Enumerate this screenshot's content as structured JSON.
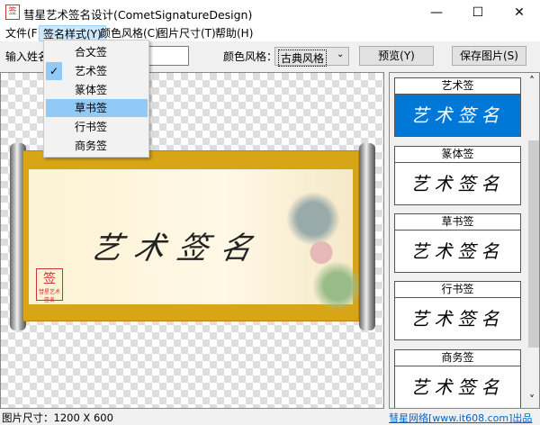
{
  "window": {
    "title": "彗星艺术签名设计(CometSignatureDesign)",
    "icon_text": "签",
    "minimize": "—",
    "maximize": "☐",
    "close": "✕"
  },
  "menubar": [
    "文件(F)",
    "签名样式(Y)",
    "颜色风格(C)",
    "图片尺寸(T)",
    "帮助(H)"
  ],
  "dropdown": {
    "items": [
      "合文签",
      "艺术签",
      "篆体签",
      "草书签",
      "行书签",
      "商务签"
    ],
    "checked": "艺术签",
    "highlighted": "草书签",
    "check_glyph": "✓"
  },
  "toolbar": {
    "name_label": "输入姓名：",
    "name_value": "",
    "color_label": "颜色风格：",
    "color_value": "古典风格",
    "preview": "预览(Y)",
    "save": "保存图片(S)"
  },
  "canvas": {
    "signature": "艺术签名",
    "seal_text": "彗星艺术签名"
  },
  "panel": {
    "cards": [
      {
        "label": "艺术签",
        "sample": "艺术签名"
      },
      {
        "label": "篆体签",
        "sample": "艺术签名"
      },
      {
        "label": "草书签",
        "sample": "艺术签名"
      },
      {
        "label": "行书签",
        "sample": "艺术签名"
      },
      {
        "label": "商务签",
        "sample": "艺术签名"
      }
    ],
    "scroll_up": "˄",
    "scroll_down": "˅"
  },
  "status": {
    "size": "图片尺寸：1200 X 600",
    "credit": "彗星网络[www.it608.com]出品"
  },
  "colors": {
    "selected_card": "#0078d7",
    "menu_highlight": "#91c9f7"
  }
}
